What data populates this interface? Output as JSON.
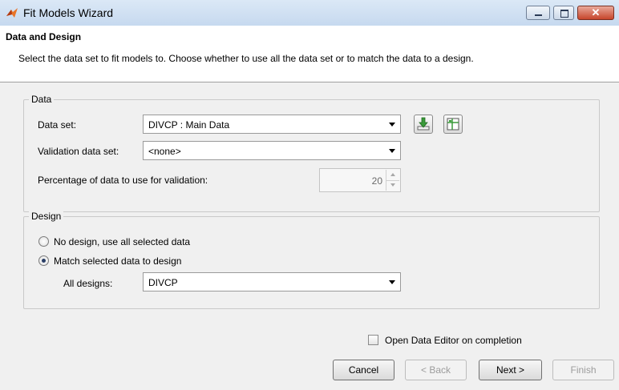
{
  "window": {
    "title": "Fit Models Wizard",
    "controls": [
      "minimize-icon",
      "maximize-icon",
      "close-icon"
    ],
    "close_glyph": "✕"
  },
  "header": {
    "title": "Data and Design",
    "description": "Select the data set to fit models to. Choose whether to use all the data set or to match the data to a design."
  },
  "data_group": {
    "label": "Data",
    "data_set_label": "Data set:",
    "data_set_value": "DIVCP : Main Data",
    "validation_label": "Validation data set:",
    "validation_value": "<none>",
    "percentage_label": "Percentage of data to use for validation:",
    "percentage_value": "20"
  },
  "design_group": {
    "label": "Design",
    "option_no_design": "No design, use all selected data",
    "option_match": "Match selected data to design",
    "selected_option": "match",
    "all_designs_label": "All designs:",
    "all_designs_value": "DIVCP"
  },
  "footer": {
    "open_editor_label": "Open Data Editor on completion",
    "open_editor_checked": false,
    "cancel": "Cancel",
    "back": "< Back",
    "next": "Next >",
    "finish": "Finish"
  },
  "colors": {
    "accent_icon": "#e8752a",
    "import_icon": "#3a9a3a",
    "titlebar": "#c6d9ef",
    "close_button": "#c7452b"
  }
}
